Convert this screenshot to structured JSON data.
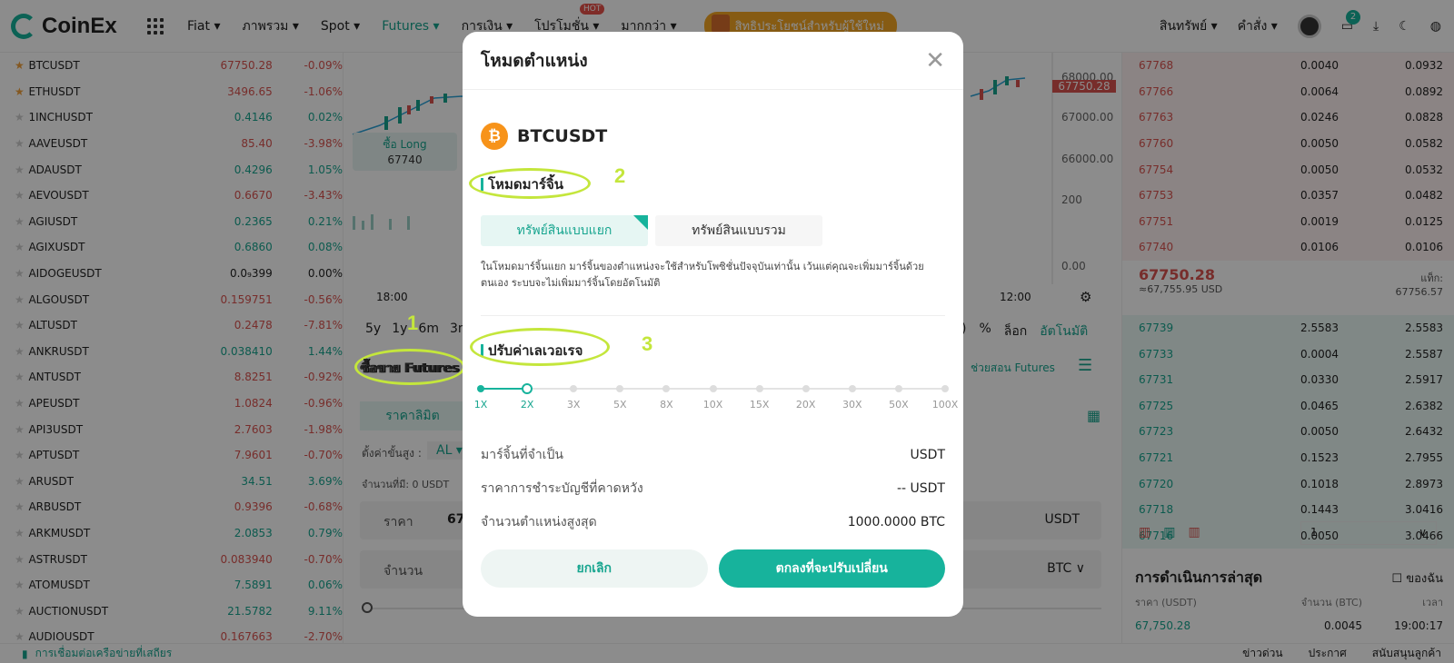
{
  "header": {
    "logo": "CoinEx",
    "nav": [
      "Fiat",
      "ภาพรวม",
      "Spot",
      "Futures",
      "การเงิน",
      "โปรโมชั่น",
      "มากกว่า"
    ],
    "hot": "HOT",
    "promo": "สิทธิประโยชน์สำหรับผู้ใช้ใหม่",
    "assets": "สินทรัพย์",
    "orders": "คำสั่ง",
    "badge_count": "2"
  },
  "markets": [
    {
      "sym": "BTCUSDT",
      "price": "67750.28",
      "chg": "-0.09%",
      "fav": true,
      "dir": "dn"
    },
    {
      "sym": "ETHUSDT",
      "price": "3496.65",
      "chg": "-1.06%",
      "fav": true,
      "dir": "dn"
    },
    {
      "sym": "1INCHUSDT",
      "price": "0.4146",
      "chg": "0.02%",
      "fav": false,
      "dir": "up"
    },
    {
      "sym": "AAVEUSDT",
      "price": "85.40",
      "chg": "-3.98%",
      "fav": false,
      "dir": "dn"
    },
    {
      "sym": "ADAUSDT",
      "price": "0.4296",
      "chg": "1.05%",
      "fav": false,
      "dir": "up"
    },
    {
      "sym": "AEVOUSDT",
      "price": "0.6670",
      "chg": "-3.43%",
      "fav": false,
      "dir": "dn"
    },
    {
      "sym": "AGIUSDT",
      "price": "0.2365",
      "chg": "0.21%",
      "fav": false,
      "dir": "up"
    },
    {
      "sym": "AGIXUSDT",
      "price": "0.6860",
      "chg": "0.08%",
      "fav": false,
      "dir": "up"
    },
    {
      "sym": "AIDOGEUSDT",
      "price": "0.0₉399",
      "chg": "0.00%",
      "fav": false,
      "dir": "nu"
    },
    {
      "sym": "ALGOUSDT",
      "price": "0.159751",
      "chg": "-0.56%",
      "fav": false,
      "dir": "dn"
    },
    {
      "sym": "ALTUSDT",
      "price": "0.2478",
      "chg": "-7.81%",
      "fav": false,
      "dir": "dn"
    },
    {
      "sym": "ANKRUSDT",
      "price": "0.038410",
      "chg": "1.44%",
      "fav": false,
      "dir": "up"
    },
    {
      "sym": "ANTUSDT",
      "price": "8.8251",
      "chg": "-0.92%",
      "fav": false,
      "dir": "dn"
    },
    {
      "sym": "APEUSDT",
      "price": "1.0824",
      "chg": "-0.96%",
      "fav": false,
      "dir": "dn"
    },
    {
      "sym": "API3USDT",
      "price": "2.7603",
      "chg": "-1.98%",
      "fav": false,
      "dir": "dn"
    },
    {
      "sym": "APTUSDT",
      "price": "7.9601",
      "chg": "-0.70%",
      "fav": false,
      "dir": "dn"
    },
    {
      "sym": "ARUSDT",
      "price": "34.51",
      "chg": "3.69%",
      "fav": false,
      "dir": "up"
    },
    {
      "sym": "ARBUSDT",
      "price": "0.9396",
      "chg": "-0.68%",
      "fav": false,
      "dir": "dn"
    },
    {
      "sym": "ARKMUSDT",
      "price": "2.0853",
      "chg": "0.79%",
      "fav": false,
      "dir": "up"
    },
    {
      "sym": "ASTRUSDT",
      "price": "0.083940",
      "chg": "-0.70%",
      "fav": false,
      "dir": "dn"
    },
    {
      "sym": "ATOMUSDT",
      "price": "7.5891",
      "chg": "0.06%",
      "fav": false,
      "dir": "up"
    },
    {
      "sym": "AUCTIONUSDT",
      "price": "21.5782",
      "chg": "9.11%",
      "fav": false,
      "dir": "up"
    },
    {
      "sym": "AUDIOUSDT",
      "price": "0.167663",
      "chg": "-2.70%",
      "fav": false,
      "dir": "dn"
    }
  ],
  "chart_area": {
    "buy_long": "ซื้อ Long",
    "buy_price": "67740",
    "y_ticks": [
      "68000.00",
      "67000.00",
      "66000.00"
    ],
    "current": "67750.28",
    "vol_tick": "200",
    "zero": "0.00",
    "times": [
      "18:00",
      "12:00"
    ],
    "ranges": [
      "5y",
      "1y",
      "6m",
      "3m"
    ],
    "right_tools": [
      ")",
      "%",
      "ล็อก",
      "อัตโนมัติ"
    ]
  },
  "trade": {
    "title": "ซื้อขาย Futures",
    "tutorial": "ช่วยสอน Futures",
    "limit": "ราคาลิมิต",
    "setting": "ตั้งค่าขั้นสูง :",
    "al": "AL",
    "avail": "จำนวนที่มี:  0 USDT",
    "price_label": "ราคา",
    "price_val": "67",
    "usdt": "USDT",
    "qty_label": "จำนวน",
    "btc": "BTC"
  },
  "orderbook": {
    "asks": [
      [
        "67768",
        "0.0040",
        "0.0932"
      ],
      [
        "67766",
        "0.0064",
        "0.0892"
      ],
      [
        "67763",
        "0.0246",
        "0.0828"
      ],
      [
        "67760",
        "0.0050",
        "0.0582"
      ],
      [
        "67754",
        "0.0050",
        "0.0532"
      ],
      [
        "67753",
        "0.0357",
        "0.0482"
      ],
      [
        "67751",
        "0.0019",
        "0.0125"
      ],
      [
        "67740",
        "0.0106",
        "0.0106"
      ]
    ],
    "mid": "67750.28",
    "mid_usd": "≈67,755.95 USD",
    "mark_label": "แท็ก:",
    "mark": "67756.57",
    "bids": [
      [
        "67739",
        "2.5583",
        "2.5583"
      ],
      [
        "67733",
        "0.0004",
        "2.5587"
      ],
      [
        "67731",
        "0.0330",
        "2.5917"
      ],
      [
        "67725",
        "0.0465",
        "2.6382"
      ],
      [
        "67723",
        "0.0050",
        "2.6432"
      ],
      [
        "67721",
        "0.1523",
        "2.7955"
      ],
      [
        "67720",
        "0.1018",
        "2.8973"
      ],
      [
        "67718",
        "0.1443",
        "3.0416"
      ],
      [
        "67716",
        "0.0050",
        "3.0466"
      ]
    ],
    "depth": "1",
    "recent_title": "การดำเนินการล่าสุด",
    "mine": "ของฉัน",
    "cols": [
      "ราคา (USDT)",
      "จำนวน (BTC)",
      "เวลา"
    ],
    "last": [
      "67,750.28",
      "0.0045",
      "19:00:17"
    ]
  },
  "bottom": {
    "conn": "การเชื่อมต่อเครือข่ายที่เสถียร",
    "news": "ข่าวด่วน",
    "notice": "ประกาศ",
    "support": "สนับสนุนลูกค้า"
  },
  "modal": {
    "title": "โหมดตำแหน่ง",
    "coin": "BTCUSDT",
    "margin_section": "โหมดมาร์จิ้น",
    "tab_isolated": "ทรัพย์สินแบบแยก",
    "tab_cross": "ทรัพย์สินแบบรวม",
    "desc": "ในโหมดมาร์จิ้นแยก มาร์จิ้นของตำแหน่งจะใช้สำหรับโพซิชั่นปัจจุบันเท่านั้น เว้นแต่คุณจะเพิ่มมาร์จิ้นด้วยตนเอง ระบบจะไม่เพิ่มมาร์จิ้นโดยอัตโนมัติ",
    "lev_section": "ปรับค่าเลเวอเรจ",
    "lev_ticks": [
      "1X",
      "2X",
      "3X",
      "5X",
      "8X",
      "10X",
      "15X",
      "20X",
      "30X",
      "50X",
      "100X"
    ],
    "lev_selected": 1,
    "rows": [
      {
        "k": "มาร์จิ้นที่จำเป็น",
        "v": "USDT"
      },
      {
        "k": "ราคาการชำระบัญชีที่คาดหวัง",
        "v": "-- USDT"
      },
      {
        "k": "จำนวนตำแหน่งสูงสุด",
        "v": "1000.0000 BTC"
      }
    ],
    "cancel": "ยกเลิก",
    "confirm": "ตกลงที่จะปรับเปลี่ยน"
  },
  "annotations": {
    "n1": "1",
    "n2": "2",
    "n3": "3"
  }
}
